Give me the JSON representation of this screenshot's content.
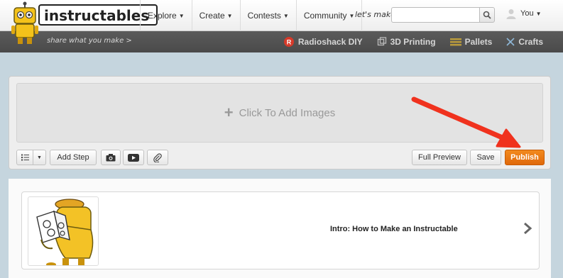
{
  "header": {
    "logo_text": "instructables",
    "nav": [
      {
        "label": "Explore"
      },
      {
        "label": "Create"
      },
      {
        "label": "Contests"
      },
      {
        "label": "Community"
      }
    ],
    "lets_make_label": "let's make",
    "search": {
      "value": "",
      "placeholder": ""
    },
    "user_label": "You"
  },
  "subbar": {
    "tagline": "share what you make >",
    "channels": [
      {
        "label": "Radioshack DIY",
        "icon": "radioshack-icon"
      },
      {
        "label": "3D Printing",
        "icon": "3d-printing-icon"
      },
      {
        "label": "Pallets",
        "icon": "pallets-icon"
      },
      {
        "label": "Crafts",
        "icon": "crafts-icon"
      }
    ]
  },
  "editor": {
    "add_images_label": "Click To Add Images",
    "add_step_label": "Add Step",
    "full_preview_label": "Full Preview",
    "save_label": "Save",
    "publish_label": "Publish"
  },
  "step": {
    "title": "Intro: How to Make an Instructable"
  },
  "colors": {
    "accent": "#f07a12",
    "annotation_arrow": "#f0321e",
    "background": "#c5d5de"
  }
}
